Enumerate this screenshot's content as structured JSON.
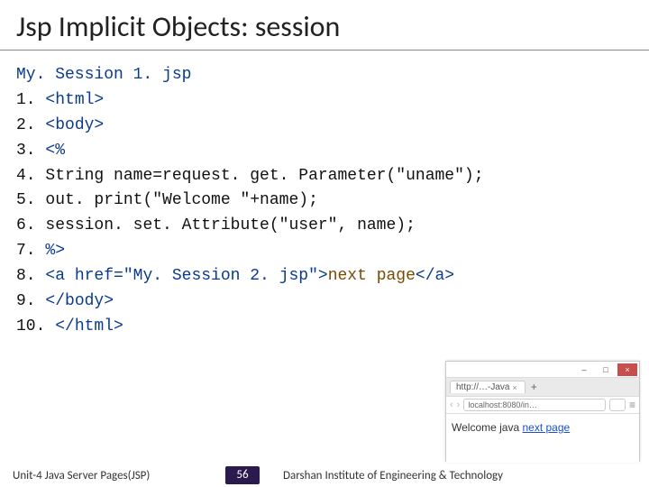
{
  "title": "Jsp Implicit Objects: session",
  "filename": "My. Session 1. jsp",
  "code": {
    "l1_num": "1.",
    "l1_tag": "<html>",
    "l2_num": "2.",
    "l2_tag": "<body>",
    "l3_num": "3.",
    "l3_tag": "<%",
    "l4_num": "4.",
    "l4_txt": "String name=request. get. Parameter(\"uname\");",
    "l5_num": "5.",
    "l5_txt": "out. print(\"Welcome \"+name);",
    "l6_num": "6.",
    "l6_txt": "session. set. Attribute(\"user\", name);",
    "l7_num": "7.",
    "l7_tag": " %>",
    "l8_num": "8.",
    "l8_a": "<a href=\"My. Session 2. jsp\">",
    "l8_t": "next page",
    "l8_c": "</a>",
    "l9_num": "9.",
    "l9_tag": "</body>",
    "l10_num": "10.",
    "l10_tag": "</html>"
  },
  "browser": {
    "tab_label": "http://…-Java",
    "tab_close": "×",
    "plus": "+",
    "nav_back": "‹",
    "nav_fwd": "›",
    "addr": "localhost:8080/in…",
    "menu": "≡",
    "body_prefix": "Welcome java ",
    "body_link": "next page"
  },
  "footer": {
    "left": "Unit-4 Java Server Pages(JSP)",
    "page": "56",
    "right": "Darshan Institute of Engineering & Technology"
  }
}
